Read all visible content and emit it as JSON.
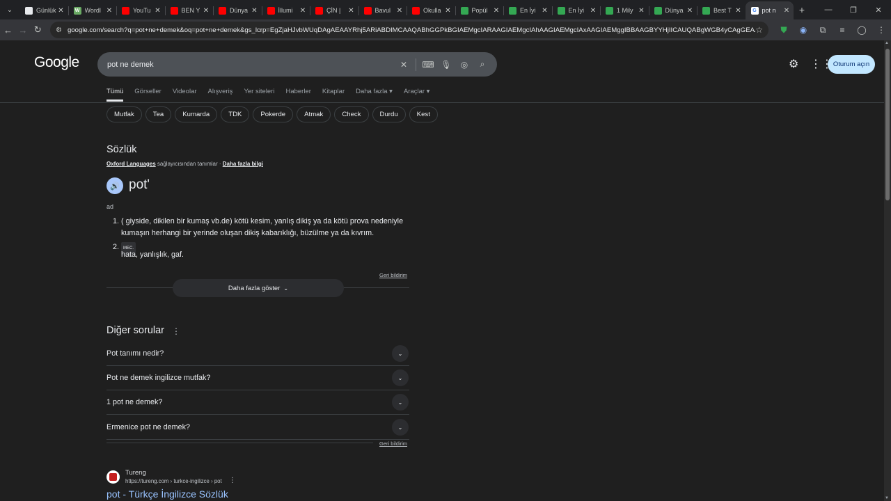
{
  "browser": {
    "tabs": [
      {
        "title": "Günlük",
        "fav_color": "#e8eaed",
        "fav_text": ""
      },
      {
        "title": "Wordl",
        "fav_color": "#6aaa64",
        "fav_text": "W"
      },
      {
        "title": "YouTu",
        "fav_color": "#ff0000",
        "fav_text": ""
      },
      {
        "title": "BEN Y",
        "fav_color": "#ff0000",
        "fav_text": ""
      },
      {
        "title": "Dünya",
        "fav_color": "#ff0000",
        "fav_text": ""
      },
      {
        "title": "İllumi",
        "fav_color": "#ff0000",
        "fav_text": ""
      },
      {
        "title": "ÇİN |",
        "fav_color": "#ff0000",
        "fav_text": ""
      },
      {
        "title": "Bavul",
        "fav_color": "#ff0000",
        "fav_text": ""
      },
      {
        "title": "Okulla",
        "fav_color": "#ff0000",
        "fav_text": ""
      },
      {
        "title": "Popül",
        "fav_color": "#34a853",
        "fav_text": ""
      },
      {
        "title": "En İyi",
        "fav_color": "#34a853",
        "fav_text": ""
      },
      {
        "title": "En İyi",
        "fav_color": "#34a853",
        "fav_text": ""
      },
      {
        "title": "1 Mily",
        "fav_color": "#34a853",
        "fav_text": ""
      },
      {
        "title": "Dünya",
        "fav_color": "#34a853",
        "fav_text": ""
      },
      {
        "title": "Best T",
        "fav_color": "#34a853",
        "fav_text": ""
      },
      {
        "title": "pot n",
        "fav_color": "#ffffff",
        "fav_text": "G",
        "active": true
      }
    ],
    "url": "google.com/search?q=pot+ne+demek&oq=pot+ne+demek&gs_lcrp=EgZjaHJvbWUqDAgAEAAYRhj5ARiABDIMCAAQABhGGPkBGIAEMgcIARAAGIAEMgcIAhAAGIAEMgcIAxAAGIAEMggIBBAAGBYYHjIICAUQABgWGB4yCAgGEAAYFhgeMg..."
  },
  "google": {
    "logo": "Google",
    "query": "pot ne demek",
    "signin": "Oturum açın",
    "nav_tabs": [
      "Tümü",
      "Görseller",
      "Videolar",
      "Alışveriş",
      "Yer siteleri",
      "Haberler",
      "Kitaplar",
      "Daha fazla ▾",
      "Araçlar ▾"
    ],
    "chips": [
      "Mutfak",
      "Tea",
      "Kumarda",
      "TDK",
      "Pokerde",
      "Atmak",
      "Check",
      "Durdu",
      "Kest"
    ]
  },
  "dictionary": {
    "heading": "Sözlük",
    "source_link": "Oxford Languages",
    "source_text": " sağlayıcısından tanımlar · ",
    "more_info": "Daha fazla bilgi",
    "word": "pot'",
    "pos": "ad",
    "def1_num": "1.",
    "def1": "( giyside, dikilen bir kumaş vb.de) kötü kesim, yanlış dikiş ya da kötü prova nedeniyle kumaşın herhangi bir yerinde oluşan dikiş kabarıklığı, büzülme ya da kıvrım.",
    "def2_num": "2.",
    "def2_tag": "MEC.",
    "def2": "hata, yanlışlık, gaf.",
    "feedback": "Geri bildirim",
    "more_button": "Daha fazla göster"
  },
  "other_questions": {
    "heading": "Diğer sorular",
    "items": [
      "Pot tanımı nedir?",
      "Pot ne demek ingilizce mutfak?",
      "1 pot ne demek?",
      "Ermenice pot ne demek?"
    ],
    "feedback": "Geri bildirim"
  },
  "result": {
    "site": "Tureng",
    "url": "https://tureng.com › turkce-ingilizce › pot",
    "title": "pot - Türkçe İngilizce Sözlük"
  }
}
